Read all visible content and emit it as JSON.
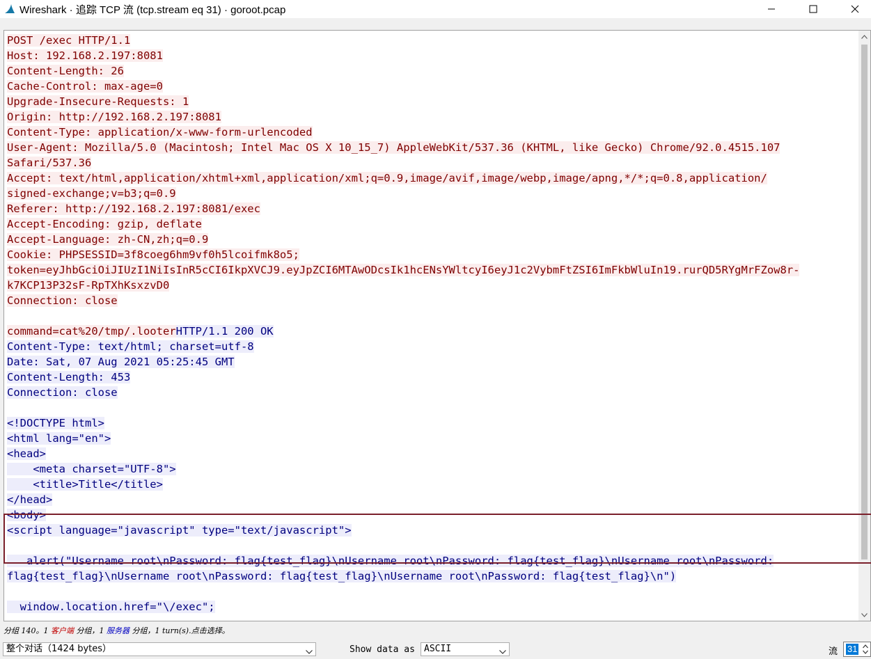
{
  "window": {
    "title": "Wireshark · 追踪 TCP 流 (tcp.stream eq 31) · goroot.pcap",
    "app_icon": "wireshark-fin-icon",
    "controls": [
      "minimize-icon",
      "maximize-icon",
      "close-icon"
    ]
  },
  "stream_lines": [
    {
      "dir": "client",
      "text": "POST /exec HTTP/1.1"
    },
    {
      "dir": "client",
      "text": "Host: 192.168.2.197:8081"
    },
    {
      "dir": "client",
      "text": "Content-Length: 26"
    },
    {
      "dir": "client",
      "text": "Cache-Control: max-age=0"
    },
    {
      "dir": "client",
      "text": "Upgrade-Insecure-Requests: 1"
    },
    {
      "dir": "client",
      "text": "Origin: http://192.168.2.197:8081"
    },
    {
      "dir": "client",
      "text": "Content-Type: application/x-www-form-urlencoded"
    },
    {
      "dir": "client",
      "text": "User-Agent: Mozilla/5.0 (Macintosh; Intel Mac OS X 10_15_7) AppleWebKit/537.36 (KHTML, like Gecko) Chrome/92.0.4515.107"
    },
    {
      "dir": "client",
      "text": "Safari/537.36"
    },
    {
      "dir": "client",
      "text": "Accept: text/html,application/xhtml+xml,application/xml;q=0.9,image/avif,image/webp,image/apng,*/*;q=0.8,application/"
    },
    {
      "dir": "client",
      "text": "signed-exchange;v=b3;q=0.9"
    },
    {
      "dir": "client",
      "text": "Referer: http://192.168.2.197:8081/exec"
    },
    {
      "dir": "client",
      "text": "Accept-Encoding: gzip, deflate"
    },
    {
      "dir": "client",
      "text": "Accept-Language: zh-CN,zh;q=0.9"
    },
    {
      "dir": "client",
      "text": "Cookie: PHPSESSID=3f8coeg6hm9vf0h5lcoifmk8o5;"
    },
    {
      "dir": "client",
      "text": "token=eyJhbGciOiJIUzI1NiIsInR5cCI6IkpXVCJ9.eyJpZCI6MTAwODcsIk1hcENsYWltcyI6eyJ1c2VybmFtZSI6ImFkbWluIn19.rurQD5RYgMrFZow8r-"
    },
    {
      "dir": "client",
      "text": "k7KCP13P32sF-RpTXhKsxzvD0"
    },
    {
      "dir": "client",
      "text": "Connection: close"
    },
    {
      "dir": "client",
      "text": ""
    },
    {
      "dir": "mixed",
      "client_text": "command=cat%20/tmp/.looter",
      "server_text": "HTTP/1.1 200 OK"
    },
    {
      "dir": "server",
      "text": "Content-Type: text/html; charset=utf-8"
    },
    {
      "dir": "server",
      "text": "Date: Sat, 07 Aug 2021 05:25:45 GMT"
    },
    {
      "dir": "server",
      "text": "Content-Length: 453"
    },
    {
      "dir": "server",
      "text": "Connection: close"
    },
    {
      "dir": "server",
      "text": ""
    },
    {
      "dir": "server",
      "text": "<!DOCTYPE html>"
    },
    {
      "dir": "server",
      "text": "<html lang=\"en\">"
    },
    {
      "dir": "server",
      "text": "<head>"
    },
    {
      "dir": "server",
      "text": "    <meta charset=\"UTF-8\">"
    },
    {
      "dir": "server",
      "text": "    <title>Title</title>"
    },
    {
      "dir": "server",
      "text": "</head>"
    },
    {
      "dir": "server",
      "text": "<body>"
    },
    {
      "dir": "server",
      "text": "<script language=\"javascript\" type=\"text/javascript\">"
    },
    {
      "dir": "server",
      "text": ""
    },
    {
      "dir": "server",
      "text": "   alert(\"Username root\\nPassword: flag{test_flag}\\nUsername root\\nPassword: flag{test_flag}\\nUsername root\\nPassword:"
    },
    {
      "dir": "server",
      "text": "flag{test_flag}\\nUsername root\\nPassword: flag{test_flag}\\nUsername root\\nPassword: flag{test_flag}\\n\")"
    },
    {
      "dir": "server",
      "text": ""
    },
    {
      "dir": "server",
      "text": "  window.location.href=\"\\/exec\";"
    }
  ],
  "status": {
    "prefix": "分组 140。1 ",
    "client_label": "客户端",
    "middle": " 分组，1 ",
    "server_label": "服务器",
    "suffix": " 分组，1 turn(s).点击选择。"
  },
  "bottom": {
    "conversation_value": "整个对话（1424 bytes）",
    "show_data_as_label": "Show data as",
    "show_data_as_value": "ASCII",
    "stream_label": "流",
    "stream_value": "31"
  },
  "colors": {
    "client_text": "#7f0000",
    "client_bg": "#fbeded",
    "server_text": "#00007f",
    "server_bg": "#ededfb",
    "highlight_box": "#7a1f2a",
    "selection": "#0078d7"
  }
}
